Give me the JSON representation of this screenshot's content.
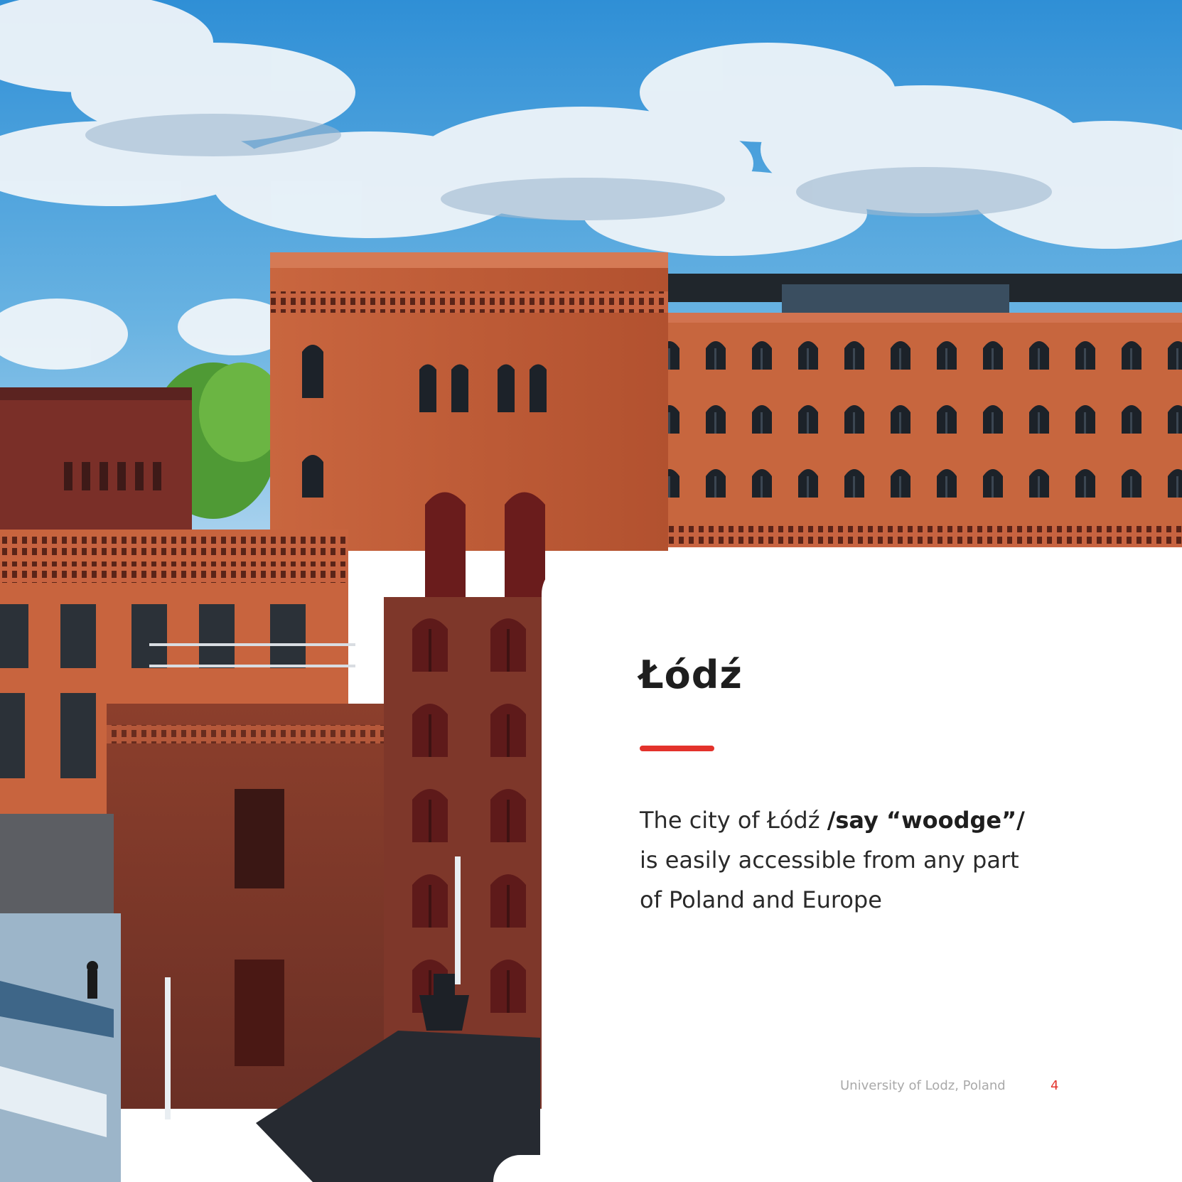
{
  "title": "Łódź",
  "body": {
    "line1_regular": "The city of Łódź ",
    "line1_bold": "/say “woodge”/",
    "line2": "is easily accessible from any part",
    "line3": "of Poland and Europe"
  },
  "footer": {
    "organization": "University of Lodz, Poland",
    "page_number": "4"
  },
  "colors": {
    "accent": "#e3322b",
    "title": "#1e1e1e",
    "footer_text": "#a9a9a9",
    "brick": "#b85a38",
    "sky": "#4a9fd8"
  }
}
